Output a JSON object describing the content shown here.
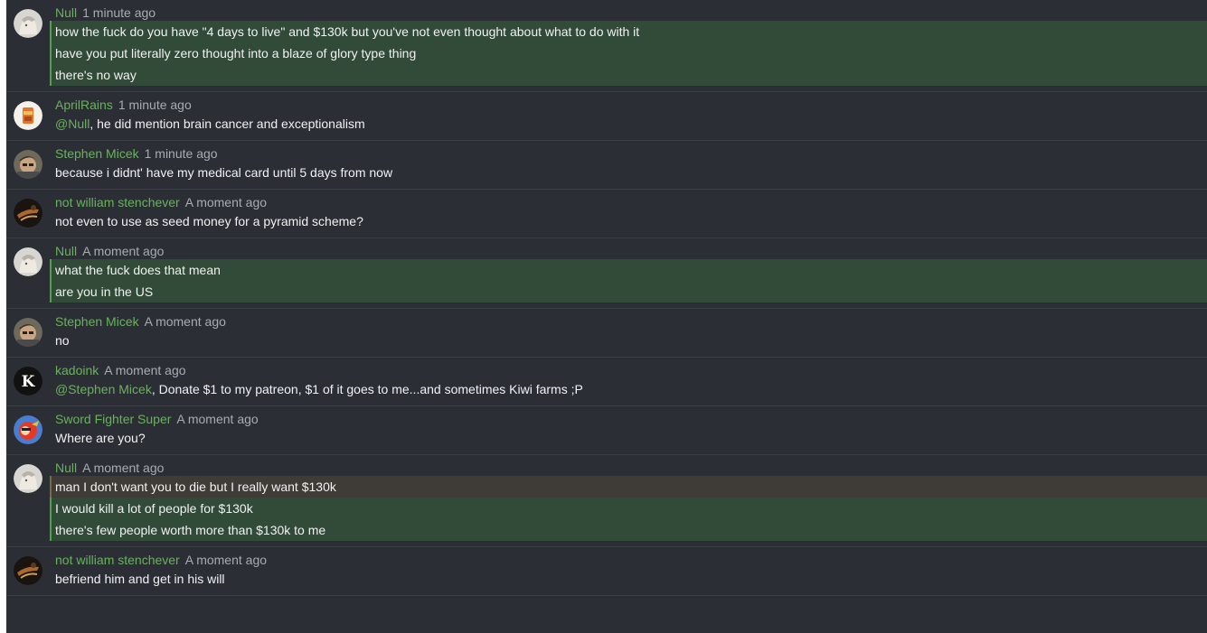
{
  "messages": [
    {
      "author": "Null",
      "time": "1 minute ago",
      "avatar": "null-avatar",
      "lines": [
        {
          "text": "how the fuck do you have \"4 days to live\" and $130k but you've not even thought about what to do with it",
          "highlight": "green"
        },
        {
          "text": "have you put literally zero thought into a blaze of glory type thing",
          "highlight": "green"
        },
        {
          "text": "there's no way",
          "highlight": "green"
        }
      ]
    },
    {
      "author": "AprilRains",
      "time": "1 minute ago",
      "avatar": "aprilrains-avatar",
      "lines": [
        {
          "mention": "@Null",
          "text": ", he did mention brain cancer and exceptionalism"
        }
      ]
    },
    {
      "author": "Stephen Micek",
      "time": "1 minute ago",
      "avatar": "stephen-avatar",
      "lines": [
        {
          "text": "because i didnt' have my medical card until 5 days from now"
        }
      ]
    },
    {
      "author": "not william stenchever",
      "time": "A moment ago",
      "avatar": "william-avatar",
      "lines": [
        {
          "text": "not even to use as seed money for a pyramid scheme?"
        }
      ]
    },
    {
      "author": "Null",
      "time": "A moment ago",
      "avatar": "null-avatar",
      "lines": [
        {
          "text": "what the fuck does that mean",
          "highlight": "green"
        },
        {
          "text": "are you in the US",
          "highlight": "green"
        }
      ]
    },
    {
      "author": "Stephen Micek",
      "time": "A moment ago",
      "avatar": "stephen-avatar",
      "lines": [
        {
          "text": "no"
        }
      ]
    },
    {
      "author": "kadoink",
      "time": "A moment ago",
      "avatar": "kadoink-avatar",
      "lines": [
        {
          "mention": "@Stephen Micek",
          "text": ", Donate $1 to my patreon, $1 of it goes to me...and sometimes Kiwi farms ;P"
        }
      ]
    },
    {
      "author": "Sword Fighter Super",
      "time": "A moment ago",
      "avatar": "sword-avatar",
      "lines": [
        {
          "text": "Where are you?"
        }
      ]
    },
    {
      "author": "Null",
      "time": "A moment ago",
      "avatar": "null-avatar",
      "lines": [
        {
          "text": "man I don't want you to die but I really want $130k",
          "highlight": "brown"
        },
        {
          "text": "I would kill a lot of people for $130k",
          "highlight": "green"
        },
        {
          "text": "there's few people worth more than $130k to me",
          "highlight": "green"
        }
      ]
    },
    {
      "author": "not william stenchever",
      "time": "A moment ago",
      "avatar": "william-avatar",
      "lines": [
        {
          "text": "befriend him and get in his will"
        }
      ]
    }
  ],
  "colors": {
    "background": "#2b2f35",
    "author": "#6bb05f",
    "timestamp": "#a7abb2",
    "message_text": "#f1f1f1",
    "highlight_green": "#324a38",
    "highlight_brown": "#3f3b36"
  }
}
